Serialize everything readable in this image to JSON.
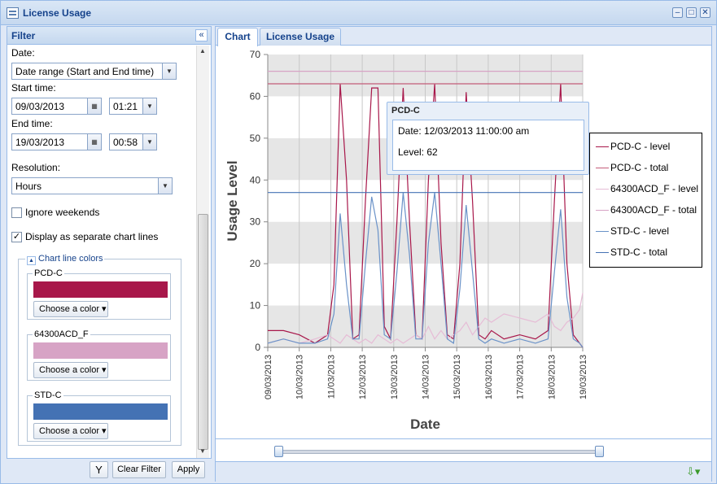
{
  "window": {
    "title": "License Usage"
  },
  "filter": {
    "title": "Filter",
    "date_label": "Date:",
    "date_value": "Date range (Start and End time)",
    "start_label": "Start time:",
    "start_date": "09/03/2013",
    "start_time": "01:21",
    "end_label": "End time:",
    "end_date": "19/03/2013",
    "end_time": "00:58",
    "resolution_label": "Resolution:",
    "resolution_value": "Hours",
    "ignore_weekends": "Ignore weekends",
    "ignore_weekends_checked": false,
    "separate_lines": "Display as separate chart lines",
    "separate_lines_checked": true,
    "colors_title": "Chart line colors",
    "groups": [
      {
        "name": "PCD-C",
        "color": "#a8174a",
        "button": "Choose a color"
      },
      {
        "name": "64300ACD_F",
        "color": "#d7a3c5",
        "button": "Choose a color"
      },
      {
        "name": "STD-C",
        "color": "#4472b4",
        "button": "Choose a color"
      }
    ],
    "clear_button": "Clear Filter",
    "apply_button": "Apply"
  },
  "tabs": [
    {
      "label": "Chart"
    },
    {
      "label": "License Usage"
    }
  ],
  "tooltip": {
    "title": "PCD-C",
    "date": "Date: 12/03/2013 11:00:00 am",
    "level": "Level: 62"
  },
  "chart_data": {
    "type": "line",
    "xlabel": "Date",
    "ylabel": "Usage Level",
    "ylim": [
      0,
      70
    ],
    "yticks": [
      "0",
      "10",
      "20",
      "30",
      "40",
      "50",
      "60",
      "70"
    ],
    "xticks": [
      "09/03/2013",
      "10/03/2013",
      "11/03/2013",
      "12/03/2013",
      "13/03/2013",
      "14/03/2013",
      "15/03/2013",
      "16/03/2013",
      "17/03/2013",
      "18/03/2013",
      "19/03/2013"
    ],
    "x": [
      0,
      0.5,
      1,
      1.5,
      1.9,
      2.1,
      2.3,
      2.5,
      2.7,
      2.9,
      3.1,
      3.3,
      3.5,
      3.7,
      3.9,
      4.1,
      4.3,
      4.5,
      4.7,
      4.9,
      5.1,
      5.3,
      5.5,
      5.7,
      5.9,
      6.1,
      6.3,
      6.5,
      6.7,
      6.9,
      7.1,
      7.5,
      8,
      8.5,
      8.9,
      9.1,
      9.3,
      9.5,
      9.7,
      9.9,
      10
    ],
    "series": [
      {
        "name": "PCD-C - level",
        "color": "#a8174a",
        "values": [
          4,
          4,
          3,
          1,
          3,
          15,
          63,
          40,
          2,
          3,
          35,
          62,
          62,
          5,
          2,
          30,
          62,
          30,
          3,
          2,
          40,
          63,
          25,
          3,
          2,
          20,
          61,
          35,
          3,
          2,
          4,
          2,
          3,
          2,
          4,
          35,
          63,
          20,
          3,
          1,
          0
        ]
      },
      {
        "name": "PCD-C - total",
        "color": "#c45c7a",
        "values": [
          63,
          63,
          63,
          63,
          63,
          63,
          63,
          63,
          63,
          63,
          63,
          63,
          63,
          63,
          63,
          63,
          63,
          63,
          63,
          63,
          63,
          63,
          63,
          63,
          63,
          63,
          63,
          63,
          63,
          63,
          63,
          63,
          63,
          63,
          63,
          63,
          63,
          63,
          63,
          63,
          63
        ]
      },
      {
        "name": "64300ACD_F - level",
        "color": "#e6bcd6",
        "values": [
          1,
          2,
          1,
          2,
          3,
          2,
          1,
          3,
          2,
          1,
          2,
          1,
          3,
          2,
          1,
          2,
          1,
          2,
          3,
          2,
          5,
          2,
          4,
          2,
          3,
          4,
          6,
          3,
          5,
          7,
          6,
          8,
          7,
          6,
          8,
          5,
          4,
          6,
          7,
          9,
          13
        ]
      },
      {
        "name": "64300ACD_F - total",
        "color": "#d7a3c5",
        "values": [
          66,
          66,
          66,
          66,
          66,
          66,
          66,
          66,
          66,
          66,
          66,
          66,
          66,
          66,
          66,
          66,
          66,
          66,
          66,
          66,
          66,
          66,
          66,
          66,
          66,
          66,
          66,
          66,
          66,
          66,
          66,
          66,
          66,
          66,
          66,
          66,
          66,
          66,
          66,
          66,
          66
        ]
      },
      {
        "name": "STD-C - level",
        "color": "#6a92c8",
        "values": [
          1,
          2,
          1,
          1,
          2,
          8,
          32,
          15,
          2,
          2,
          20,
          36,
          28,
          3,
          2,
          18,
          37,
          22,
          2,
          2,
          25,
          37,
          20,
          2,
          1,
          14,
          34,
          18,
          2,
          1,
          2,
          1,
          2,
          1,
          2,
          18,
          33,
          12,
          2,
          1,
          0
        ]
      },
      {
        "name": "STD-C - total",
        "color": "#4472b4",
        "values": [
          37,
          37,
          37,
          37,
          37,
          37,
          37,
          37,
          37,
          37,
          37,
          37,
          37,
          37,
          37,
          37,
          37,
          37,
          37,
          37,
          37,
          37,
          37,
          37,
          37,
          37,
          37,
          37,
          37,
          37,
          37,
          37,
          37,
          37,
          37,
          37,
          37,
          37,
          37,
          37,
          37
        ]
      }
    ]
  }
}
